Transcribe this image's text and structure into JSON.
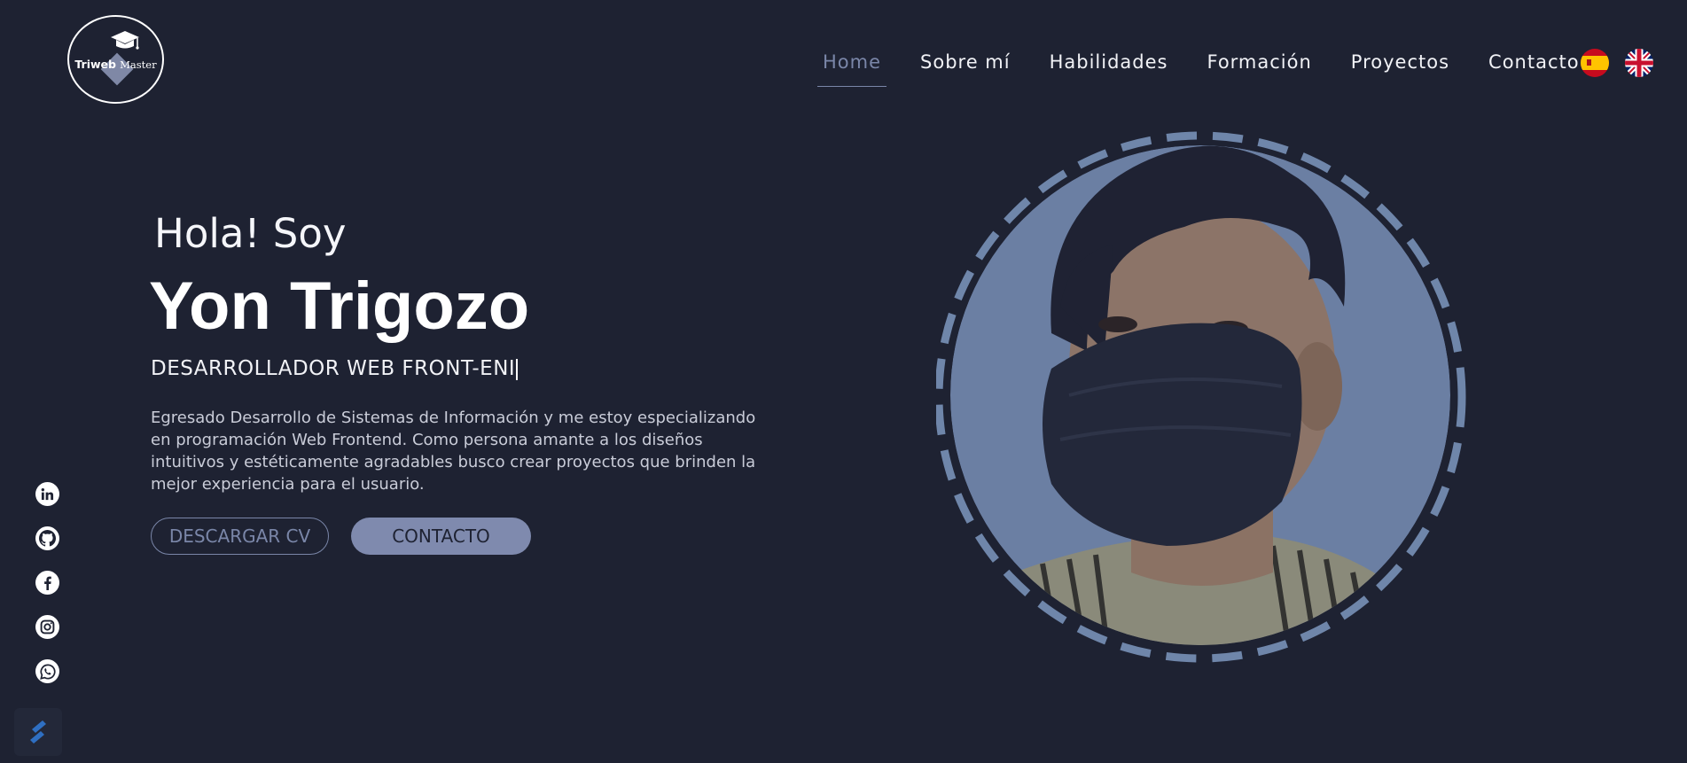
{
  "logo": {
    "text_a": "Triweb",
    "text_b": "Master"
  },
  "nav": {
    "items": [
      "Home",
      "Sobre mí",
      "Habilidades",
      "Formación",
      "Proyectos",
      "Contacto"
    ],
    "active": "Home"
  },
  "languages": [
    "spanish-flag-icon",
    "uk-flag-icon"
  ],
  "hero": {
    "greeting": "Hola! Soy",
    "name": "Yon Trigozo",
    "role": "DESARROLLADOR WEB FRONT-ENI",
    "description": "Egresado Desarrollo de Sistemas de Información y me estoy especializando en programación Web Frontend. Como persona amante a los diseños intuitivos y estéticamente agradables busco crear proyectos que brinden la mejor experiencia para el usuario.",
    "download_cv_label": "DESCARGAR CV",
    "contact_label": "CONTACTO"
  },
  "social": [
    "linkedin-icon",
    "github-icon",
    "facebook-icon",
    "instagram-icon",
    "whatsapp-icon"
  ],
  "colors": {
    "background": "#1e2232",
    "accent": "#7f8aae",
    "portrait_bg": "#6b7fa3",
    "dashed_ring": "#6f86aa"
  }
}
